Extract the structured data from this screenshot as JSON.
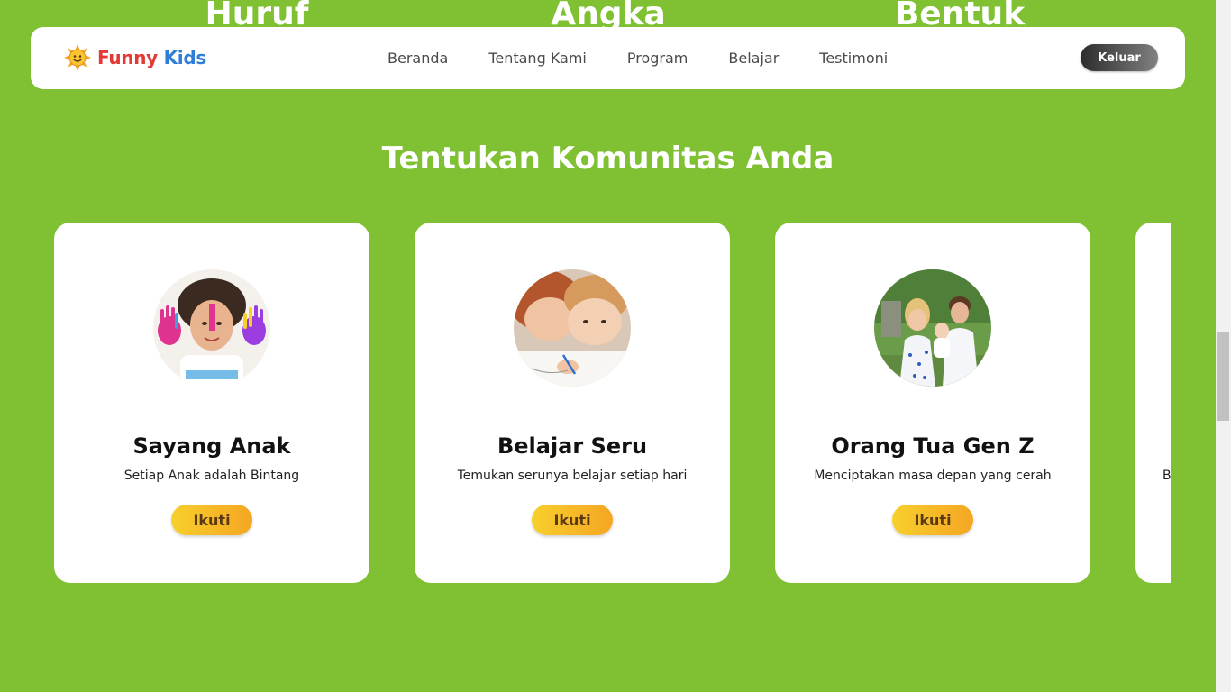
{
  "peek_headings": [
    "Huruf",
    "Angka",
    "Bentuk"
  ],
  "navbar": {
    "logo": {
      "word1": "Funny",
      "word2": "Kids",
      "icon": "sun-icon"
    },
    "links": [
      "Beranda",
      "Tentang Kami",
      "Program",
      "Belajar",
      "Testimoni"
    ],
    "logout_label": "Keluar"
  },
  "section": {
    "title": "Tentukan Komunitas Anda"
  },
  "cards": [
    {
      "title": "Sayang Anak",
      "desc": "Setiap Anak adalah Bintang",
      "button": "Ikuti",
      "photo": "child-painted-hands-photo"
    },
    {
      "title": "Belajar Seru",
      "desc": "Temukan serunya belajar setiap hari",
      "button": "Ikuti",
      "photo": "children-drawing-photo"
    },
    {
      "title": "Orang Tua Gen Z",
      "desc": "Menciptakan masa depan yang cerah",
      "button": "Ikuti",
      "photo": "family-outdoor-photo"
    },
    {
      "title": "",
      "desc": "B",
      "button": "",
      "photo": ""
    }
  ],
  "colors": {
    "page_background": "#7fc133",
    "button_gradient": [
      "#f7cf2c",
      "#f5a623"
    ],
    "logout_gradient": [
      "#2d2d2d",
      "#808080"
    ]
  }
}
